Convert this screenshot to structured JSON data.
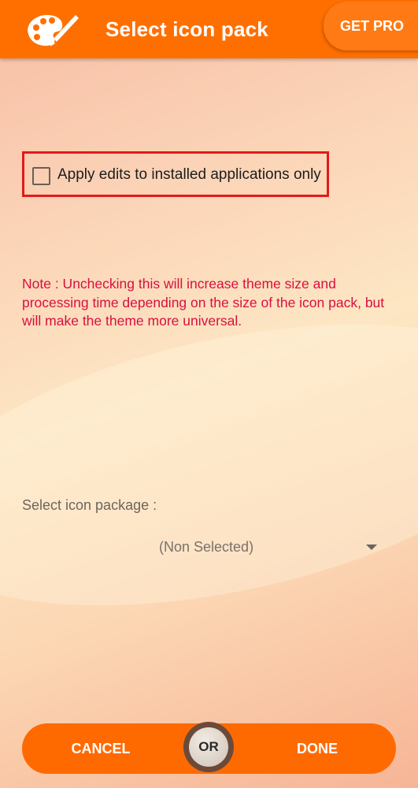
{
  "app_bar": {
    "title": "Select icon pack",
    "get_pro_label": "GET PRO",
    "logo_icon": "palette-icon",
    "color": "#ff6f00"
  },
  "options": {
    "apply_label": "Apply edits to installed applications only",
    "apply_checked": false
  },
  "note": "Note : Unchecking this will increase theme size and processing time depending on the size of the icon pack, but will make the theme more universal.",
  "icon_package": {
    "label": "Select icon package :",
    "selected": "(Non Selected)"
  },
  "bottom": {
    "cancel_label": "CANCEL",
    "or_label": "OR",
    "done_label": "DONE"
  }
}
